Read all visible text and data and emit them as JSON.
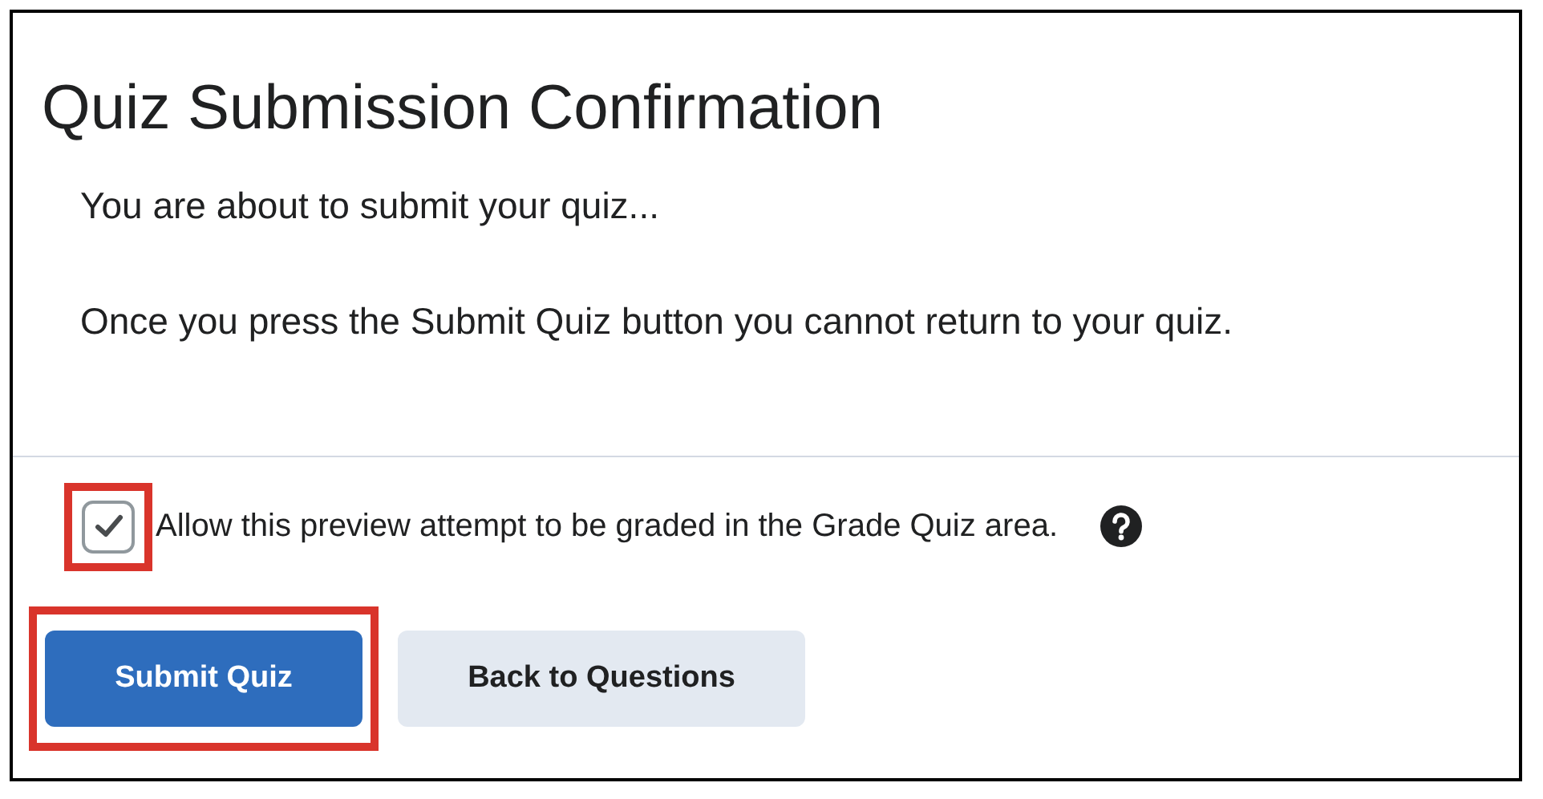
{
  "title": "Quiz Submission Confirmation",
  "messages": [
    "You are about to submit your quiz...",
    "Once you press the Submit Quiz button you cannot return to your quiz."
  ],
  "checkbox": {
    "label": "Allow this preview attempt to be graded in the Grade Quiz area.",
    "checked": true,
    "highlighted": true
  },
  "buttons": [
    {
      "label": "Submit Quiz",
      "kind": "primary",
      "highlighted": true
    },
    {
      "label": "Back to Questions",
      "kind": "secondary",
      "highlighted": false
    }
  ]
}
